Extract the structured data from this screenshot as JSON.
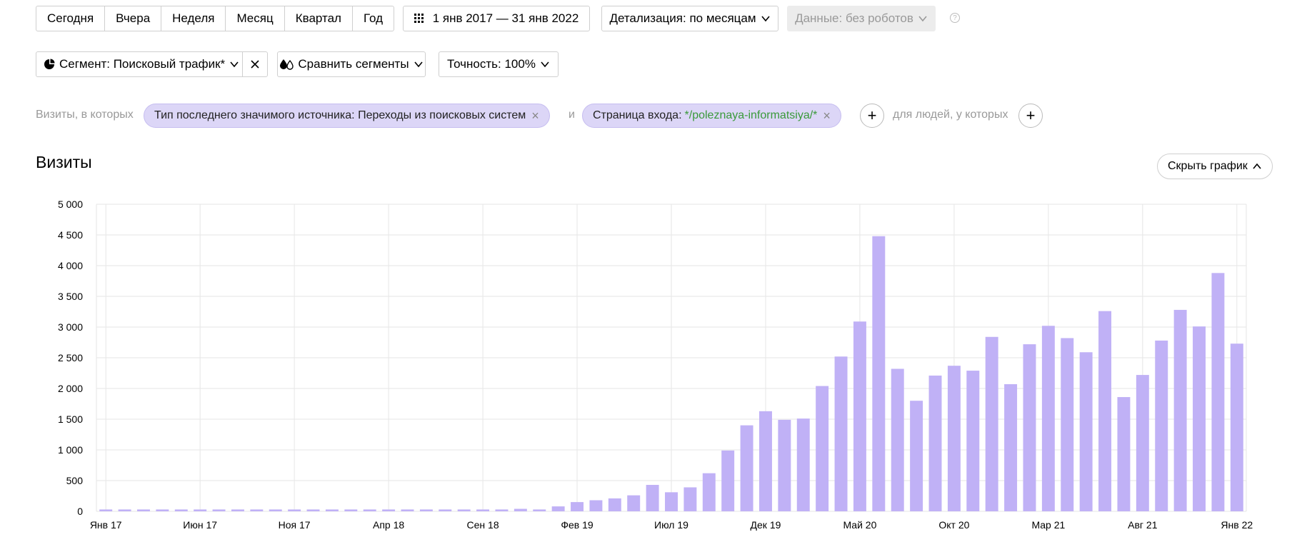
{
  "period_buttons": [
    "Сегодня",
    "Вчера",
    "Неделя",
    "Месяц",
    "Квартал",
    "Год"
  ],
  "date_range": "1 янв 2017 — 31 янв 2022",
  "detail_label": "Детализация: по месяцам",
  "data_filter": "Данные: без роботов",
  "help": "?",
  "segment_label": "Сегмент: Поисковый трафик*",
  "compare_label": "Сравнить сегменты",
  "accuracy_label": "Точность: 100%",
  "filters": {
    "prefix": "Визиты, в которых",
    "chip1": "Тип последнего значимого источника: Переходы из поисковых систем",
    "and": "и",
    "chip2_label": "Страница входа: ",
    "chip2_value": "*/poleznaya-informatsiya/*",
    "people": "для людей, у которых"
  },
  "chart_title": "Визиты",
  "hide_chart": "Скрыть график",
  "colors": {
    "bar": "#c0b1f6",
    "grid": "#e6e6e6",
    "chip": "#dcd6f7"
  },
  "chart_data": {
    "type": "bar",
    "title": "Визиты",
    "ylim": [
      0,
      5000
    ],
    "y_ticks": [
      "0",
      "500",
      "1 000",
      "1 500",
      "2 000",
      "2 500",
      "3 000",
      "3 500",
      "4 000",
      "4 500",
      "5 000"
    ],
    "x_ticks": [
      {
        "label": "Янв 17",
        "index": 0
      },
      {
        "label": "Июн 17",
        "index": 5
      },
      {
        "label": "Ноя 17",
        "index": 10
      },
      {
        "label": "Апр 18",
        "index": 15
      },
      {
        "label": "Сен 18",
        "index": 20
      },
      {
        "label": "Фев 19",
        "index": 25
      },
      {
        "label": "Июл 19",
        "index": 30
      },
      {
        "label": "Дек 19",
        "index": 35
      },
      {
        "label": "Май 20",
        "index": 40
      },
      {
        "label": "Окт 20",
        "index": 45
      },
      {
        "label": "Мар 21",
        "index": 50
      },
      {
        "label": "Авг 21",
        "index": 55
      },
      {
        "label": "Янв 22",
        "index": 60
      }
    ],
    "values": [
      30,
      30,
      30,
      30,
      30,
      30,
      30,
      30,
      30,
      30,
      30,
      30,
      30,
      30,
      30,
      30,
      30,
      30,
      30,
      30,
      30,
      30,
      40,
      30,
      80,
      150,
      180,
      210,
      260,
      430,
      310,
      390,
      620,
      990,
      1400,
      1630,
      1490,
      1510,
      2040,
      2520,
      3090,
      4480,
      2320,
      1800,
      2210,
      2370,
      2290,
      2840,
      2070,
      2720,
      3020,
      2820,
      2590,
      3260,
      1860,
      2220,
      2780,
      3280,
      3010,
      3880,
      2730
    ]
  }
}
